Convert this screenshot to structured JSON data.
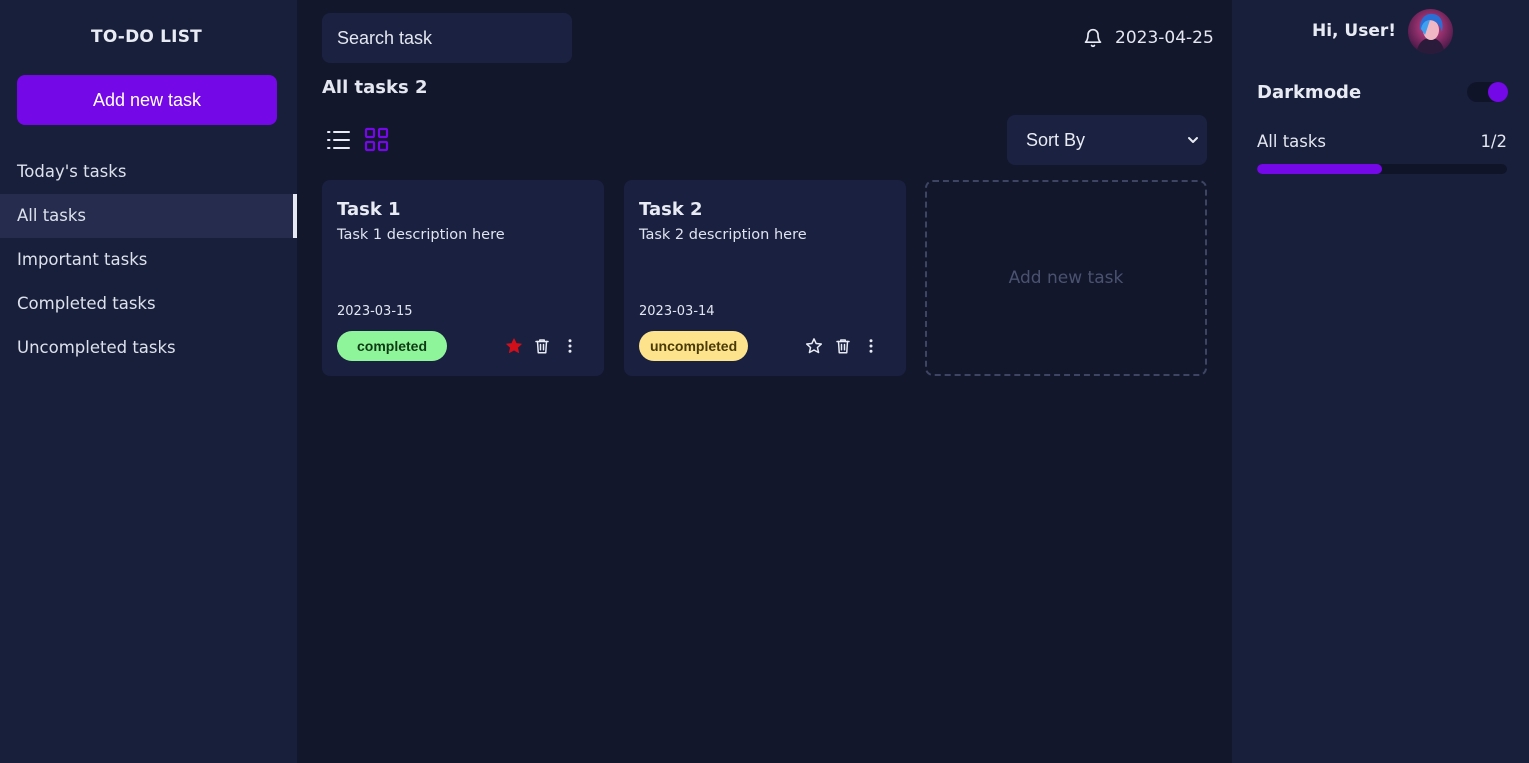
{
  "app": {
    "title": "TO-DO LIST",
    "add_task_label": "Add new task"
  },
  "sidebar": {
    "items": [
      {
        "label": "Today's tasks",
        "active": false
      },
      {
        "label": "All tasks",
        "active": true
      },
      {
        "label": "Important tasks",
        "active": false
      },
      {
        "label": "Completed tasks",
        "active": false
      },
      {
        "label": "Uncompleted tasks",
        "active": false
      }
    ]
  },
  "header": {
    "search_placeholder": "Search task",
    "date": "2023-04-25",
    "page_title": "All tasks 2",
    "sort_label": "Sort By"
  },
  "tasks": [
    {
      "title": "Task 1",
      "description": "Task 1 description here",
      "date": "2023-03-15",
      "status": "completed",
      "status_bg": "#8ff59a",
      "status_color": "#0f3a14",
      "important": true
    },
    {
      "title": "Task 2",
      "description": "Task 2 description here",
      "date": "2023-03-14",
      "status": "uncompleted",
      "status_bg": "#fde38b",
      "status_color": "#4a3a05",
      "important": false
    }
  ],
  "add_card_label": "Add new task",
  "user_panel": {
    "greeting": "Hi, User!",
    "darkmode_label": "Darkmode",
    "darkmode_on": true,
    "progress_label": "All tasks",
    "progress_count": "1/2",
    "progress_fraction": 0.5
  },
  "colors": {
    "accent": "#7408e6",
    "important_star": "#d10f1b"
  },
  "icons": {
    "notification": "bell-icon",
    "list_view": "list-view-icon",
    "grid_view": "grid-view-icon",
    "important": "star-icon",
    "delete": "trash-icon",
    "more": "more-vertical-icon"
  }
}
